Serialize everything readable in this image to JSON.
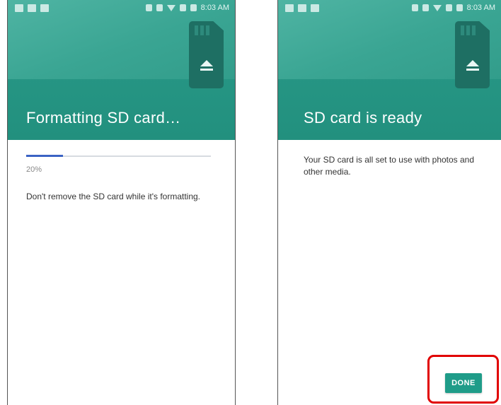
{
  "status_bar": {
    "time": "8:03 AM"
  },
  "left_screen": {
    "title": "Formatting SD card…",
    "progress_percent": 20,
    "progress_label": "20%",
    "message": "Don't remove the SD card while it's formatting."
  },
  "right_screen": {
    "title": "SD card is ready",
    "message": "Your SD card is all set to use with photos and other media.",
    "done_label": "DONE"
  },
  "colors": {
    "teal": "#2a9b8a",
    "progress": "#3b63c4",
    "button": "#1f9c89",
    "highlight": "#e10000"
  }
}
